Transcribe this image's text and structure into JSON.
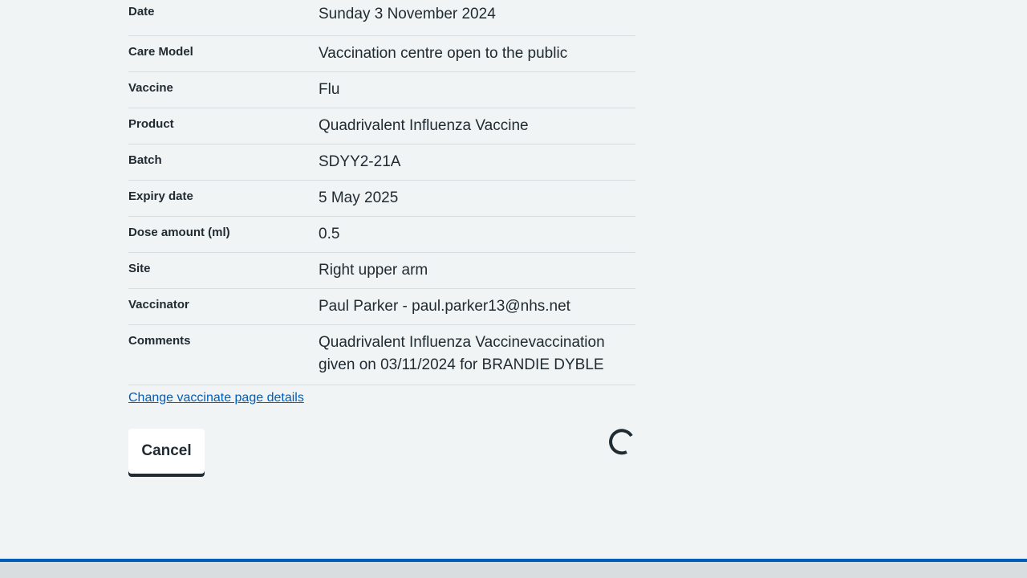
{
  "summary": {
    "rows": [
      {
        "key": "Date",
        "value": "Sunday 3 November 2024"
      },
      {
        "key": "Care Model",
        "value": "Vaccination centre open to the public"
      },
      {
        "key": "Vaccine",
        "value": "Flu"
      },
      {
        "key": "Product",
        "value": "Quadrivalent Influenza Vaccine"
      },
      {
        "key": "Batch",
        "value": "SDYY2-21A"
      },
      {
        "key": "Expiry date",
        "value": "5 May 2025"
      },
      {
        "key": "Dose amount (ml)",
        "value": "0.5"
      },
      {
        "key": "Site",
        "value": "Right upper arm"
      },
      {
        "key": "Vaccinator",
        "value": "Paul Parker - paul.parker13@nhs.net"
      },
      {
        "key": "Comments",
        "value": "Quadrivalent Influenza Vaccinevaccination given on 03/11/2024 for BRANDIE DYBLE"
      }
    ]
  },
  "change_link": "Change vaccinate page details",
  "actions": {
    "cancel_label": "Cancel",
    "spinner_icon": "loading-spinner-icon"
  },
  "colors": {
    "background": "#f0f4f5",
    "link": "#005eb8",
    "text": "#212b32",
    "footer_accent": "#005eb8"
  }
}
